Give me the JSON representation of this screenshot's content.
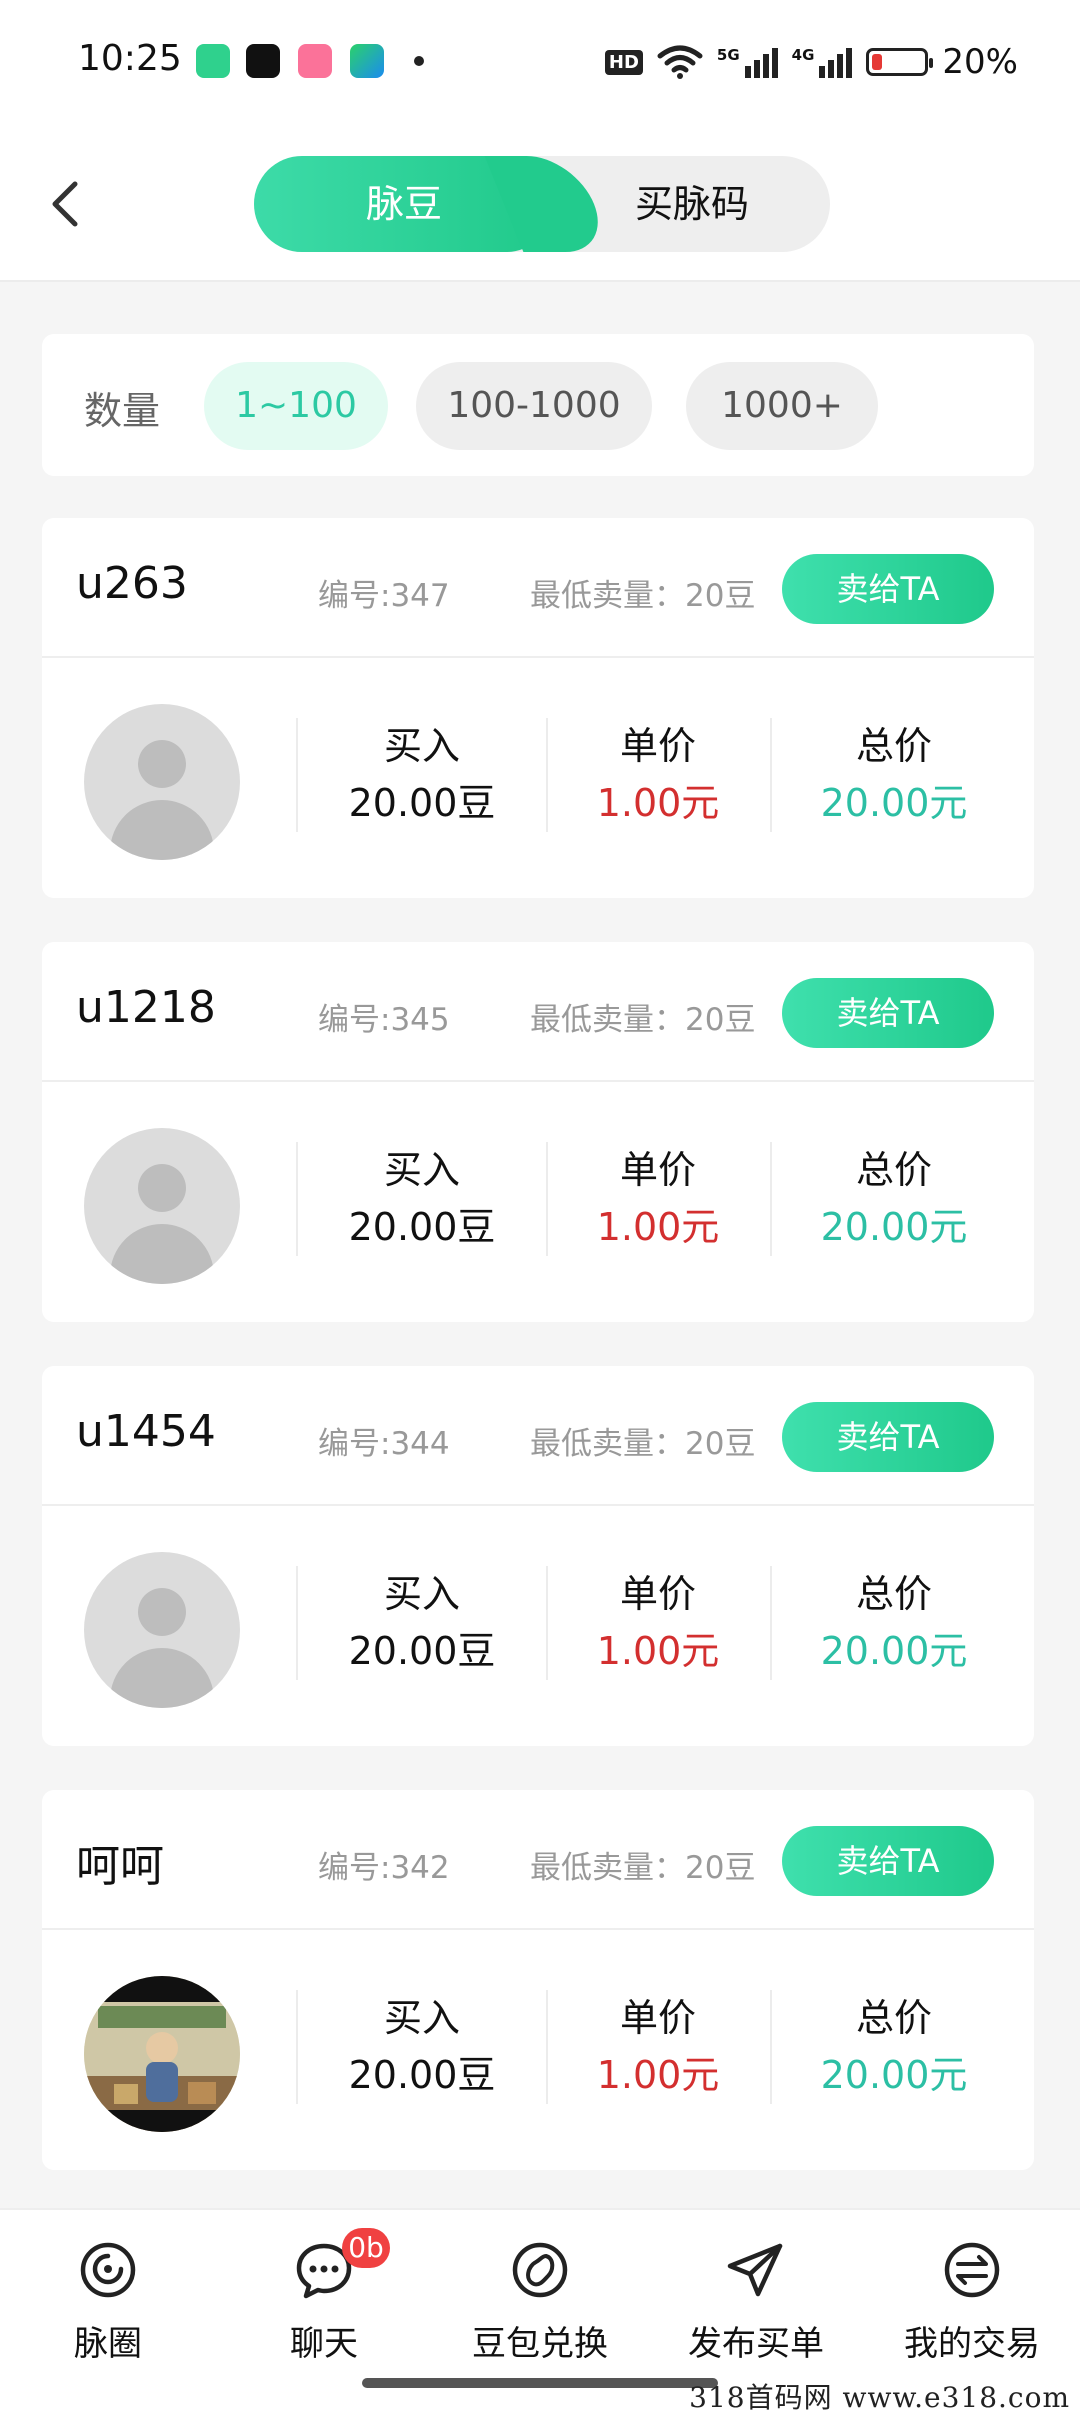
{
  "status_bar": {
    "time": "10:25",
    "hd_label": "HD",
    "network_5g": "5G",
    "network_4g": "4G",
    "battery_text": "20%",
    "battery_level": 0.2
  },
  "header": {
    "tabs": [
      {
        "label": "脉豆",
        "active": true
      },
      {
        "label": "买脉码",
        "active": false
      }
    ]
  },
  "filter": {
    "label": "数量",
    "options": [
      {
        "label": "1~100",
        "active": true
      },
      {
        "label": "100-1000",
        "active": false
      },
      {
        "label": "1000+",
        "active": false
      }
    ]
  },
  "sellers": [
    {
      "username": "u263",
      "id_text": "编号:347",
      "min_sell_text": "最低卖量：20豆",
      "button": "卖给TA",
      "buy_label": "买入",
      "buy_value": "20.00豆",
      "unit_label": "单价",
      "unit_value": "1.00元",
      "total_label": "总价",
      "total_value": "20.00元",
      "avatar": "default"
    },
    {
      "username": "u1218",
      "id_text": "编号:345",
      "min_sell_text": "最低卖量：20豆",
      "button": "卖给TA",
      "buy_label": "买入",
      "buy_value": "20.00豆",
      "unit_label": "单价",
      "unit_value": "1.00元",
      "total_label": "总价",
      "total_value": "20.00元",
      "avatar": "default"
    },
    {
      "username": "u1454",
      "id_text": "编号:344",
      "min_sell_text": "最低卖量：20豆",
      "button": "卖给TA",
      "buy_label": "买入",
      "buy_value": "20.00豆",
      "unit_label": "单价",
      "unit_value": "1.00元",
      "total_label": "总价",
      "total_value": "20.00元",
      "avatar": "default"
    },
    {
      "username": "呵呵",
      "id_text": "编号:342",
      "min_sell_text": "最低卖量：20豆",
      "button": "卖给TA",
      "buy_label": "买入",
      "buy_value": "20.00豆",
      "unit_label": "单价",
      "unit_value": "1.00元",
      "total_label": "总价",
      "total_value": "20.00元",
      "avatar": "photo"
    }
  ],
  "bottom_nav": {
    "items": [
      {
        "label": "脉圈",
        "icon": "circle-swirl-icon"
      },
      {
        "label": "聊天",
        "icon": "chat-icon",
        "badge": "0b"
      },
      {
        "label": "豆包兑换",
        "icon": "bean-icon"
      },
      {
        "label": "发布买单",
        "icon": "send-icon"
      },
      {
        "label": "我的交易",
        "icon": "exchange-icon"
      }
    ]
  },
  "watermark": "318首码网  www.e318.com",
  "colors": {
    "accent": "#22cb8d",
    "price_red": "#d32f2f",
    "total_teal": "#2cbfa4"
  }
}
